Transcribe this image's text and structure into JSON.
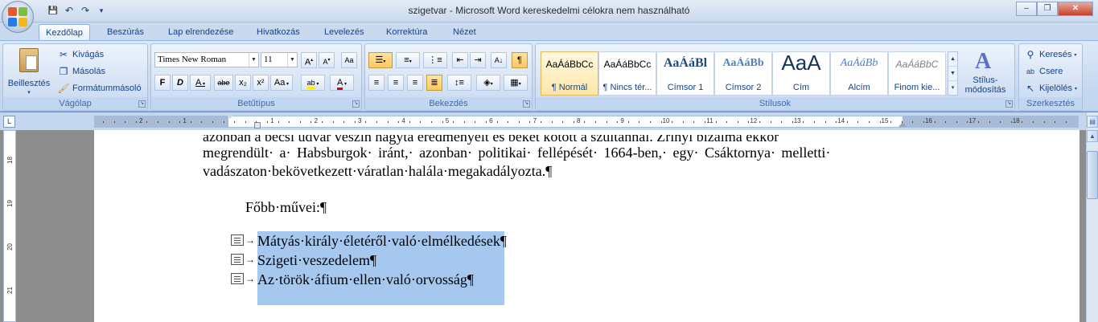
{
  "window": {
    "title": "szigetvar - Microsoft Word kereskedelmi célokra nem használható",
    "minimize": "–",
    "restore": "❐",
    "close": "✕"
  },
  "qat": {
    "save": "💾",
    "undo": "↶",
    "redo": "↷",
    "customize": "▾"
  },
  "tabs": [
    "Kezdőlap",
    "Beszúrás",
    "Lap elrendezése",
    "Hivatkozás",
    "Levelezés",
    "Korrektúra",
    "Nézet"
  ],
  "ribbon": {
    "clipboard": {
      "label": "Vágólap",
      "paste": "Beillesztés",
      "cut": "Kivágás",
      "copy": "Másolás",
      "format_painter": "Formátummásoló"
    },
    "font": {
      "label": "Betűtípus",
      "font_name": "Times New Roman",
      "font_size": "11",
      "grow": "A",
      "shrink": "A",
      "clear": "Aa",
      "bold": "F",
      "italic": "D",
      "underline": "A",
      "strike": "abe",
      "subscript": "x₂",
      "superscript": "x²",
      "change_case": "Aa",
      "highlight": "ab",
      "font_color": "A"
    },
    "paragraph": {
      "label": "Bekezdés",
      "show_marks": "¶"
    },
    "styles": {
      "label": "Stílusok",
      "items": [
        {
          "preview": "AaÁáBbCc",
          "name": "¶ Normál"
        },
        {
          "preview": "AaÁáBbCc",
          "name": "¶ Nincs tér..."
        },
        {
          "preview": "AaÁáBl",
          "name": "Címsor 1"
        },
        {
          "preview": "AaÁáBb",
          "name": "Címsor 2"
        },
        {
          "preview": "AaA",
          "name": "Cím"
        },
        {
          "preview": "AaÁáBb",
          "name": "Alcím"
        },
        {
          "preview": "AaÁáBbC",
          "name": "Finom kie..."
        }
      ],
      "change_styles": "Stílus-\nmódosítás"
    },
    "editing": {
      "label": "Szerkesztés",
      "find": "Keresés",
      "replace": "Csere",
      "select": "Kijelölés"
    }
  },
  "ruler": {
    "numbers": [
      "2",
      "1",
      "1",
      "2",
      "3",
      "4",
      "5",
      "6",
      "7",
      "8",
      "9",
      "10",
      "11",
      "12",
      "13",
      "14",
      "15",
      "16",
      "17",
      "18"
    ],
    "corner": "L"
  },
  "vertical_ruler": {
    "numbers": [
      "18",
      "19",
      "20",
      "21"
    ]
  },
  "document": {
    "line0": "azonban a bécsi udvar vészin hagyta eredményeit és békét kötött a szultánnal. Zrínyi bizalma ekkor",
    "line1": "megrendült· a· Habsburgok· iránt,· azonban· politikai· fellépését· 1664-ben,· egy· Csáktornya· melletti·",
    "line2": "vadászaton·bekövetkezett·váratlan·halála·megakadályozta.¶",
    "heading": "Főbb·művei:¶",
    "list": [
      "Mátyás·király·életéről·való·elmélkedések¶",
      "Szigeti·veszedelem¶",
      "Az·török·áfium·ellen·való·orvosság¶"
    ]
  }
}
